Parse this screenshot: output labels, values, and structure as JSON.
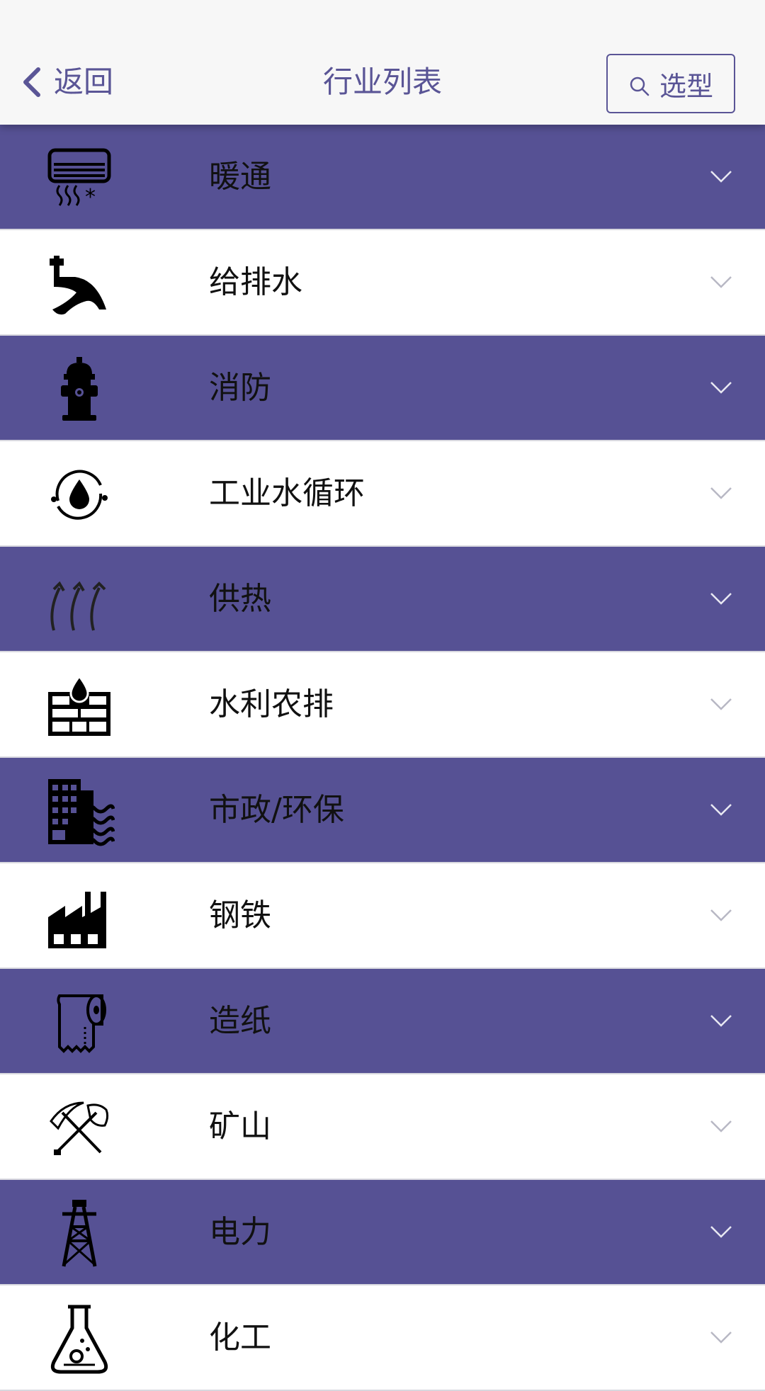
{
  "header": {
    "back_label": "返回",
    "title": "行业列表",
    "select_label": "选型"
  },
  "colors": {
    "accent": "#565194",
    "header_bg": "#f7f7f7",
    "row_white": "#ffffff"
  },
  "industries": [
    {
      "label": "暖通",
      "icon": "air-conditioner-icon"
    },
    {
      "label": "给排水",
      "icon": "faucet-icon"
    },
    {
      "label": "消防",
      "icon": "fire-hydrant-icon"
    },
    {
      "label": "工业水循环",
      "icon": "water-cycle-icon"
    },
    {
      "label": "供热",
      "icon": "heat-arrows-icon"
    },
    {
      "label": "水利农排",
      "icon": "water-wall-icon"
    },
    {
      "label": "市政/环保",
      "icon": "building-waves-icon"
    },
    {
      "label": "钢铁",
      "icon": "factory-icon"
    },
    {
      "label": "造纸",
      "icon": "paper-roll-icon"
    },
    {
      "label": "矿山",
      "icon": "pickaxe-shovel-icon"
    },
    {
      "label": "电力",
      "icon": "power-tower-icon"
    },
    {
      "label": "化工",
      "icon": "flask-icon"
    }
  ]
}
